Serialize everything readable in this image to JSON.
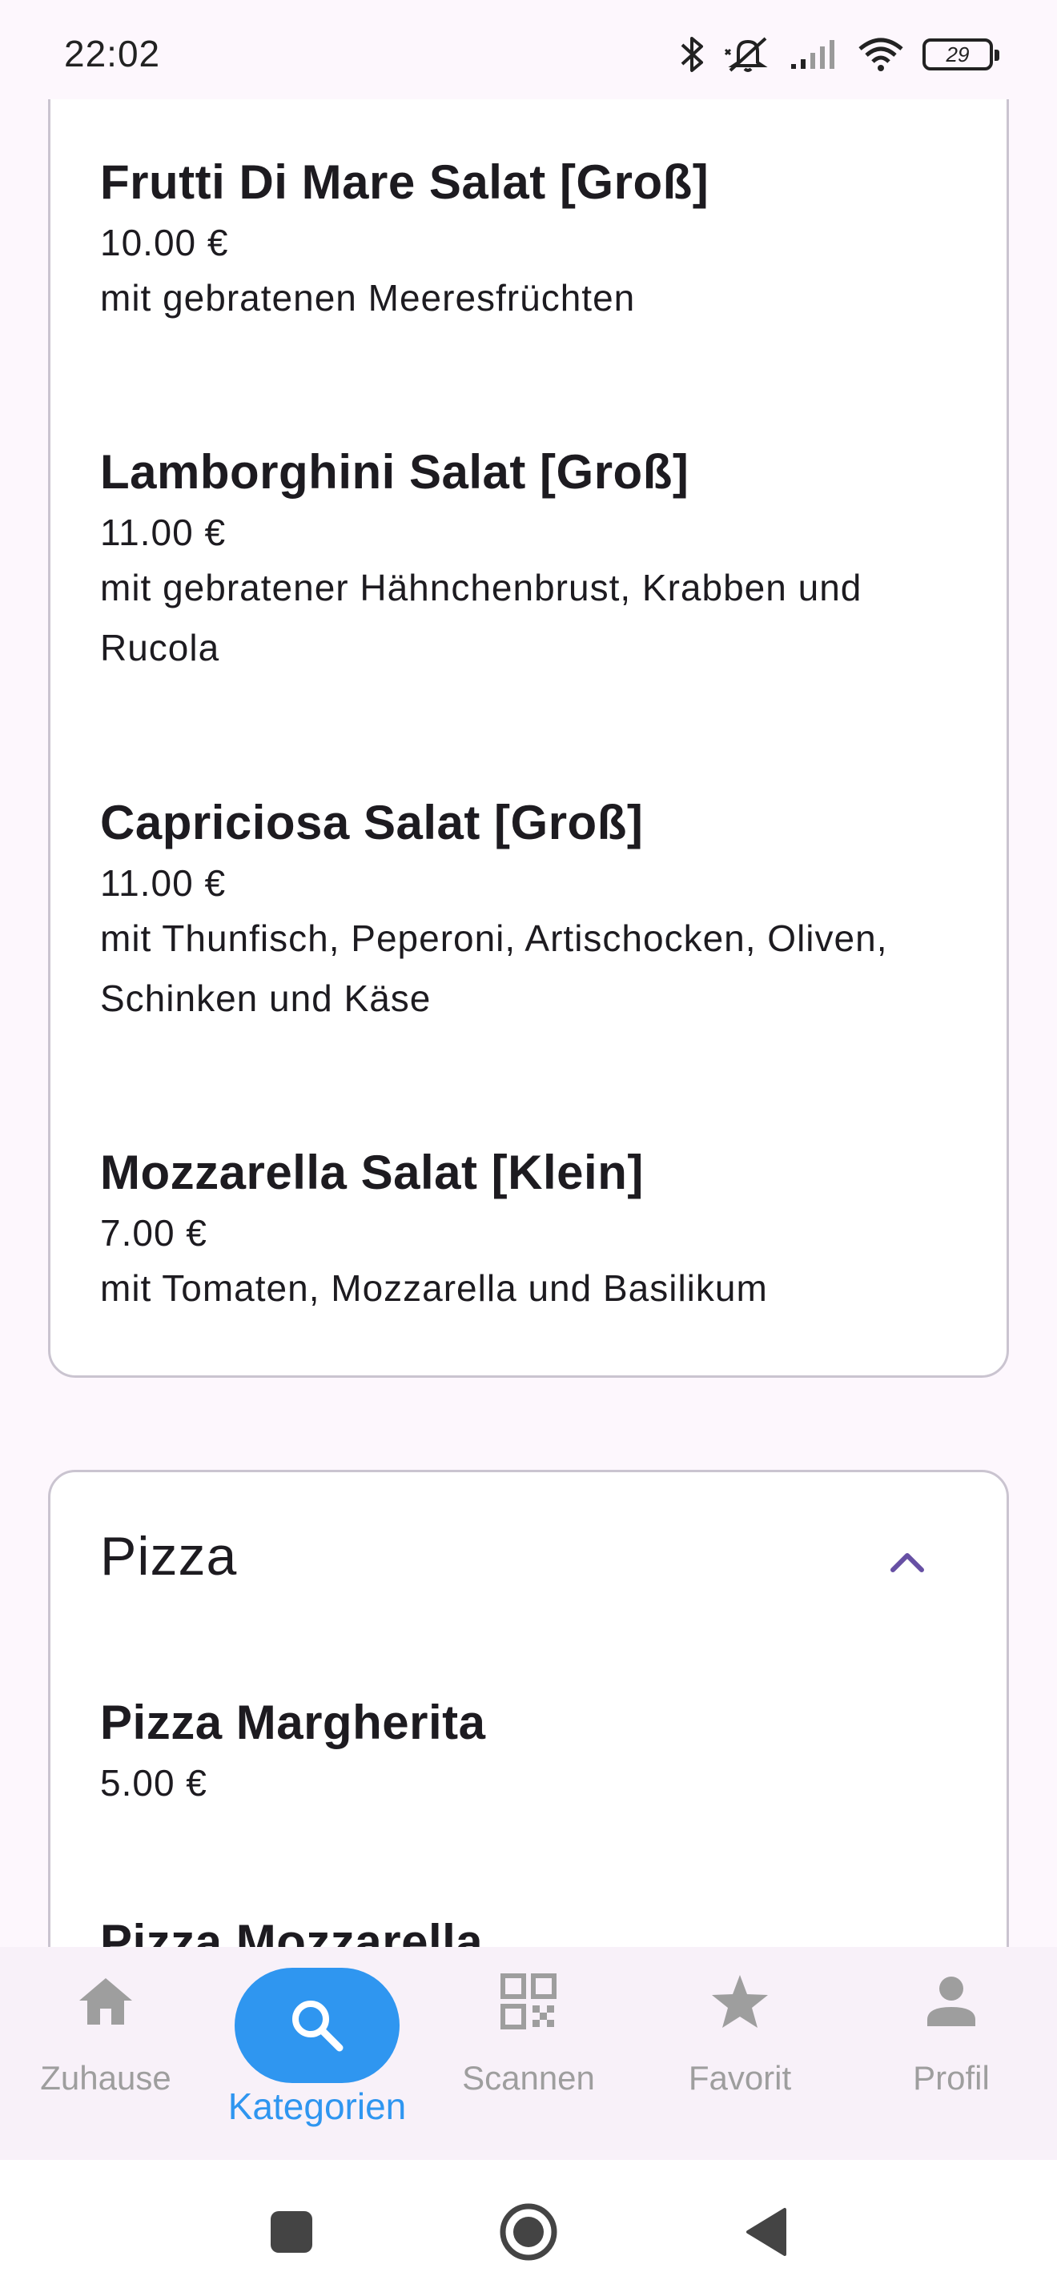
{
  "status_bar": {
    "time": "22:02",
    "battery_level": "29",
    "icons": [
      "bluetooth-icon",
      "mute-icon",
      "signal-icon",
      "wifi-icon",
      "battery-icon"
    ]
  },
  "salat_card": {
    "items": [
      {
        "name": "Frutti Di Mare Salat [Groß]",
        "price": "10.00 €",
        "description": "mit gebratenen Meeresfrüchten"
      },
      {
        "name": "Lamborghini Salat [Groß]",
        "price": "11.00 €",
        "description": "mit gebratener Hähnchenbrust, Krabben und Rucola"
      },
      {
        "name": "Capriciosa Salat [Groß]",
        "price": "11.00 €",
        "description": "mit Thunfisch, Peperoni, Artischocken, Oliven, Schinken und Käse"
      },
      {
        "name": "Mozzarella Salat [Klein]",
        "price": "7.00 €",
        "description": "mit Tomaten, Mozzarella und Basilikum"
      }
    ]
  },
  "pizza_card": {
    "title": "Pizza",
    "collapse_icon": "chevron-up-icon",
    "items": [
      {
        "name": "Pizza Margherita",
        "price": "5.00 €"
      },
      {
        "name": "Pizza Mozzarella"
      }
    ]
  },
  "bottom_nav": {
    "items": [
      {
        "label": "Zuhause",
        "icon": "home-icon"
      },
      {
        "label": "Kategorien",
        "icon": "search-icon",
        "active": true
      },
      {
        "label": "Scannen",
        "icon": "qr-code-icon"
      },
      {
        "label": "Favorit",
        "icon": "star-icon"
      },
      {
        "label": "Profil",
        "icon": "person-icon"
      }
    ]
  },
  "system_nav": {
    "buttons": [
      "recents-button",
      "home-button",
      "back-button"
    ]
  },
  "colors": {
    "background": "#fdf7fd",
    "card_border": "#cac4d0",
    "accent_blue": "#2f96f0",
    "chevron_purple": "#6750a4",
    "inactive_nav": "#9e9e9e"
  }
}
